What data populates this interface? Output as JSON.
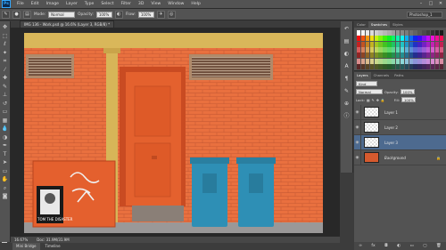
{
  "app": {
    "logo": "Ps"
  },
  "menu": [
    "File",
    "Edit",
    "Image",
    "Layer",
    "Type",
    "Select",
    "Filter",
    "3D",
    "View",
    "Window",
    "Help"
  ],
  "window_controls": {
    "minimize": "–",
    "maximize": "□",
    "close": "✕"
  },
  "options_bar": {
    "mode_label": "Mode:",
    "mode_value": "Normal",
    "opacity_label": "Opacity:",
    "opacity_value": "100%",
    "flow_label": "Flow:",
    "flow_value": "100%",
    "workspace": "Photoshop_1"
  },
  "document": {
    "tab_title": "IMG 136 - Work.psd @ 16.6% (Layer 3, RGB/8) *",
    "zoom": "16.67%",
    "doc_info": "Doc: 31.9M/31.9M"
  },
  "bottom_tabs": [
    "Mini Bridge",
    "Timeline"
  ],
  "swatches_panel": {
    "tabs": [
      "Color",
      "Swatches",
      "Styles"
    ],
    "active": "Swatches"
  },
  "layers_panel": {
    "tabs": [
      "Layers",
      "Channels",
      "Paths"
    ],
    "active": "Layers",
    "kind_label": "Kind",
    "blend_mode": "Normal",
    "opacity_label": "Opacity:",
    "opacity_value": "100%",
    "lock_label": "Lock:",
    "fill_label": "Fill:",
    "fill_value": "100%",
    "layers": [
      {
        "name": "Layer 1",
        "selected": false,
        "visible": true
      },
      {
        "name": "Layer 2",
        "selected": false,
        "visible": true
      },
      {
        "name": "Layer 3",
        "selected": true,
        "visible": true
      },
      {
        "name": "Background",
        "selected": false,
        "visible": true,
        "italic": true,
        "locked": true
      }
    ]
  },
  "canvas_text": {
    "poster_text": "TOM THE DISASTER"
  },
  "colors": {
    "brick": "#e9703f",
    "door": "#e4612e",
    "bin": "#2e8fb5",
    "frame_yellow": "#d9b75a",
    "selected_layer": "#4d6a8f"
  }
}
